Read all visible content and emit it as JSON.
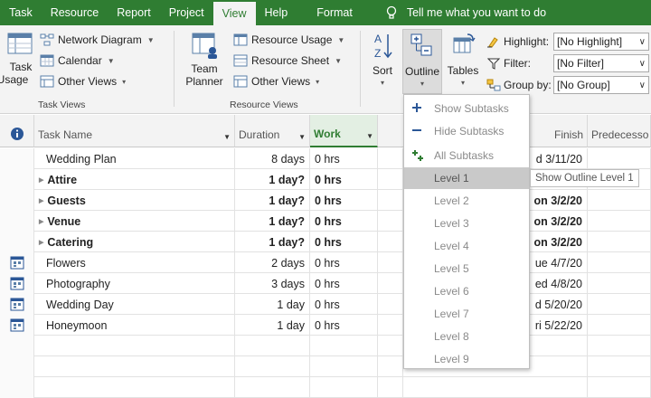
{
  "tabs": [
    "Task",
    "Resource",
    "Report",
    "Project",
    "View",
    "Help",
    "Format"
  ],
  "tell_me": "Tell me what you want to do",
  "ribbon": {
    "task_usage": {
      "line1": "Task",
      "line2": "Usage"
    },
    "network_diagram": "Network Diagram",
    "calendar": "Calendar",
    "other_views_task": "Other Views",
    "task_views_label": "Task Views",
    "team_planner": {
      "line1": "Team",
      "line2": "Planner"
    },
    "resource_usage": "Resource Usage",
    "resource_sheet": "Resource Sheet",
    "other_views_res": "Other Views",
    "resource_views_label": "Resource Views",
    "sort": "Sort",
    "outline": "Outline",
    "tables": "Tables",
    "highlight": {
      "label": "Highlight:",
      "value": "[No Highlight]"
    },
    "filter": {
      "label": "Filter:",
      "value": "[No Filter]"
    },
    "group_by": {
      "label": "Group by:",
      "value": "[No Group]"
    }
  },
  "columns": {
    "task_name": "Task Name",
    "duration": "Duration",
    "work": "Work",
    "finish": "Finish",
    "predecessors": "Predecesso"
  },
  "rows": [
    {
      "name": "Wedding Plan",
      "duration": "8 days",
      "work": "0 hrs",
      "finish": "d 3/11/20",
      "bold": false,
      "summary": false,
      "icon": false
    },
    {
      "name": "Attire",
      "duration": "1 day?",
      "work": "0 hrs",
      "finish": "",
      "bold": true,
      "summary": true,
      "icon": false
    },
    {
      "name": "Guests",
      "duration": "1 day?",
      "work": "0 hrs",
      "finish": "on 3/2/20",
      "bold": true,
      "summary": true,
      "icon": false
    },
    {
      "name": "Venue",
      "duration": "1 day?",
      "work": "0 hrs",
      "finish": "on 3/2/20",
      "bold": true,
      "summary": true,
      "icon": false
    },
    {
      "name": "Catering",
      "duration": "1 day?",
      "work": "0 hrs",
      "finish": "on 3/2/20",
      "bold": true,
      "summary": true,
      "icon": false
    },
    {
      "name": "Flowers",
      "duration": "2 days",
      "work": "0 hrs",
      "finish": "ue 4/7/20",
      "bold": false,
      "summary": false,
      "icon": true
    },
    {
      "name": "Photography",
      "duration": "3 days",
      "work": "0 hrs",
      "finish": "ed 4/8/20",
      "bold": false,
      "summary": false,
      "icon": true
    },
    {
      "name": "Wedding Day",
      "duration": "1 day",
      "work": "0 hrs",
      "finish": "d 5/20/20",
      "bold": false,
      "summary": false,
      "icon": true
    },
    {
      "name": "Honeymoon",
      "duration": "1 day",
      "work": "0 hrs",
      "finish": "ri 5/22/20",
      "bold": false,
      "summary": false,
      "icon": true
    }
  ],
  "menu": {
    "show_subtasks": "Show Subtasks",
    "hide_subtasks": "Hide Subtasks",
    "all_subtasks": "All Subtasks",
    "levels": [
      "Level 1",
      "Level 2",
      "Level 3",
      "Level 4",
      "Level 5",
      "Level 6",
      "Level 7",
      "Level 8",
      "Level 9"
    ]
  },
  "tooltip": "Show Outline Level 1",
  "colors": {
    "accent": "#2f7d32",
    "ribbon_bg": "#f3f3f3",
    "menu_highlight": "#c9c9c9"
  }
}
